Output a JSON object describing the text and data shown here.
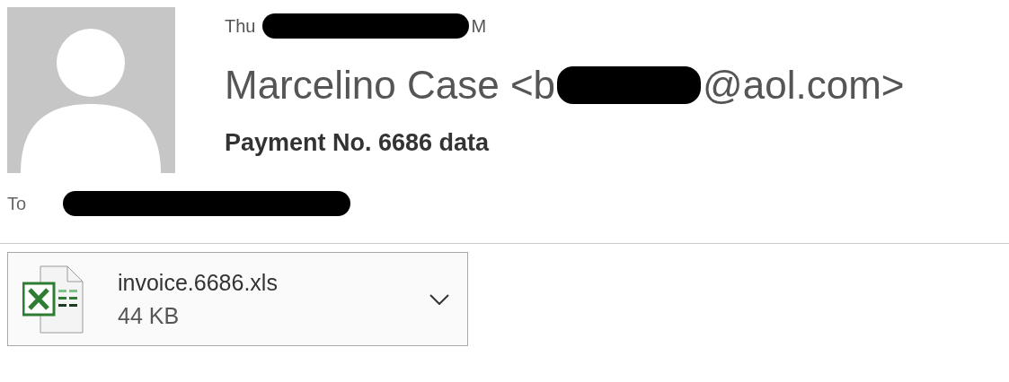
{
  "message": {
    "date": [
      {
        "kind": "text",
        "text": "Thu"
      },
      {
        "kind": "redacted"
      },
      {
        "kind": "text",
        "text": "M"
      }
    ],
    "sender": [
      {
        "kind": "text",
        "text": "Marcelino Case <b"
      },
      {
        "kind": "redacted"
      },
      {
        "kind": "text",
        "text": "@aol.com>"
      }
    ],
    "subject": "Payment No. 6686 data",
    "to": [
      {
        "kind": "label",
        "text": "To"
      },
      {
        "kind": "redacted"
      }
    ]
  },
  "attachments": [
    {
      "kind": "excel",
      "name": "invoice.6686.xls",
      "size": "44 KB"
    }
  ]
}
